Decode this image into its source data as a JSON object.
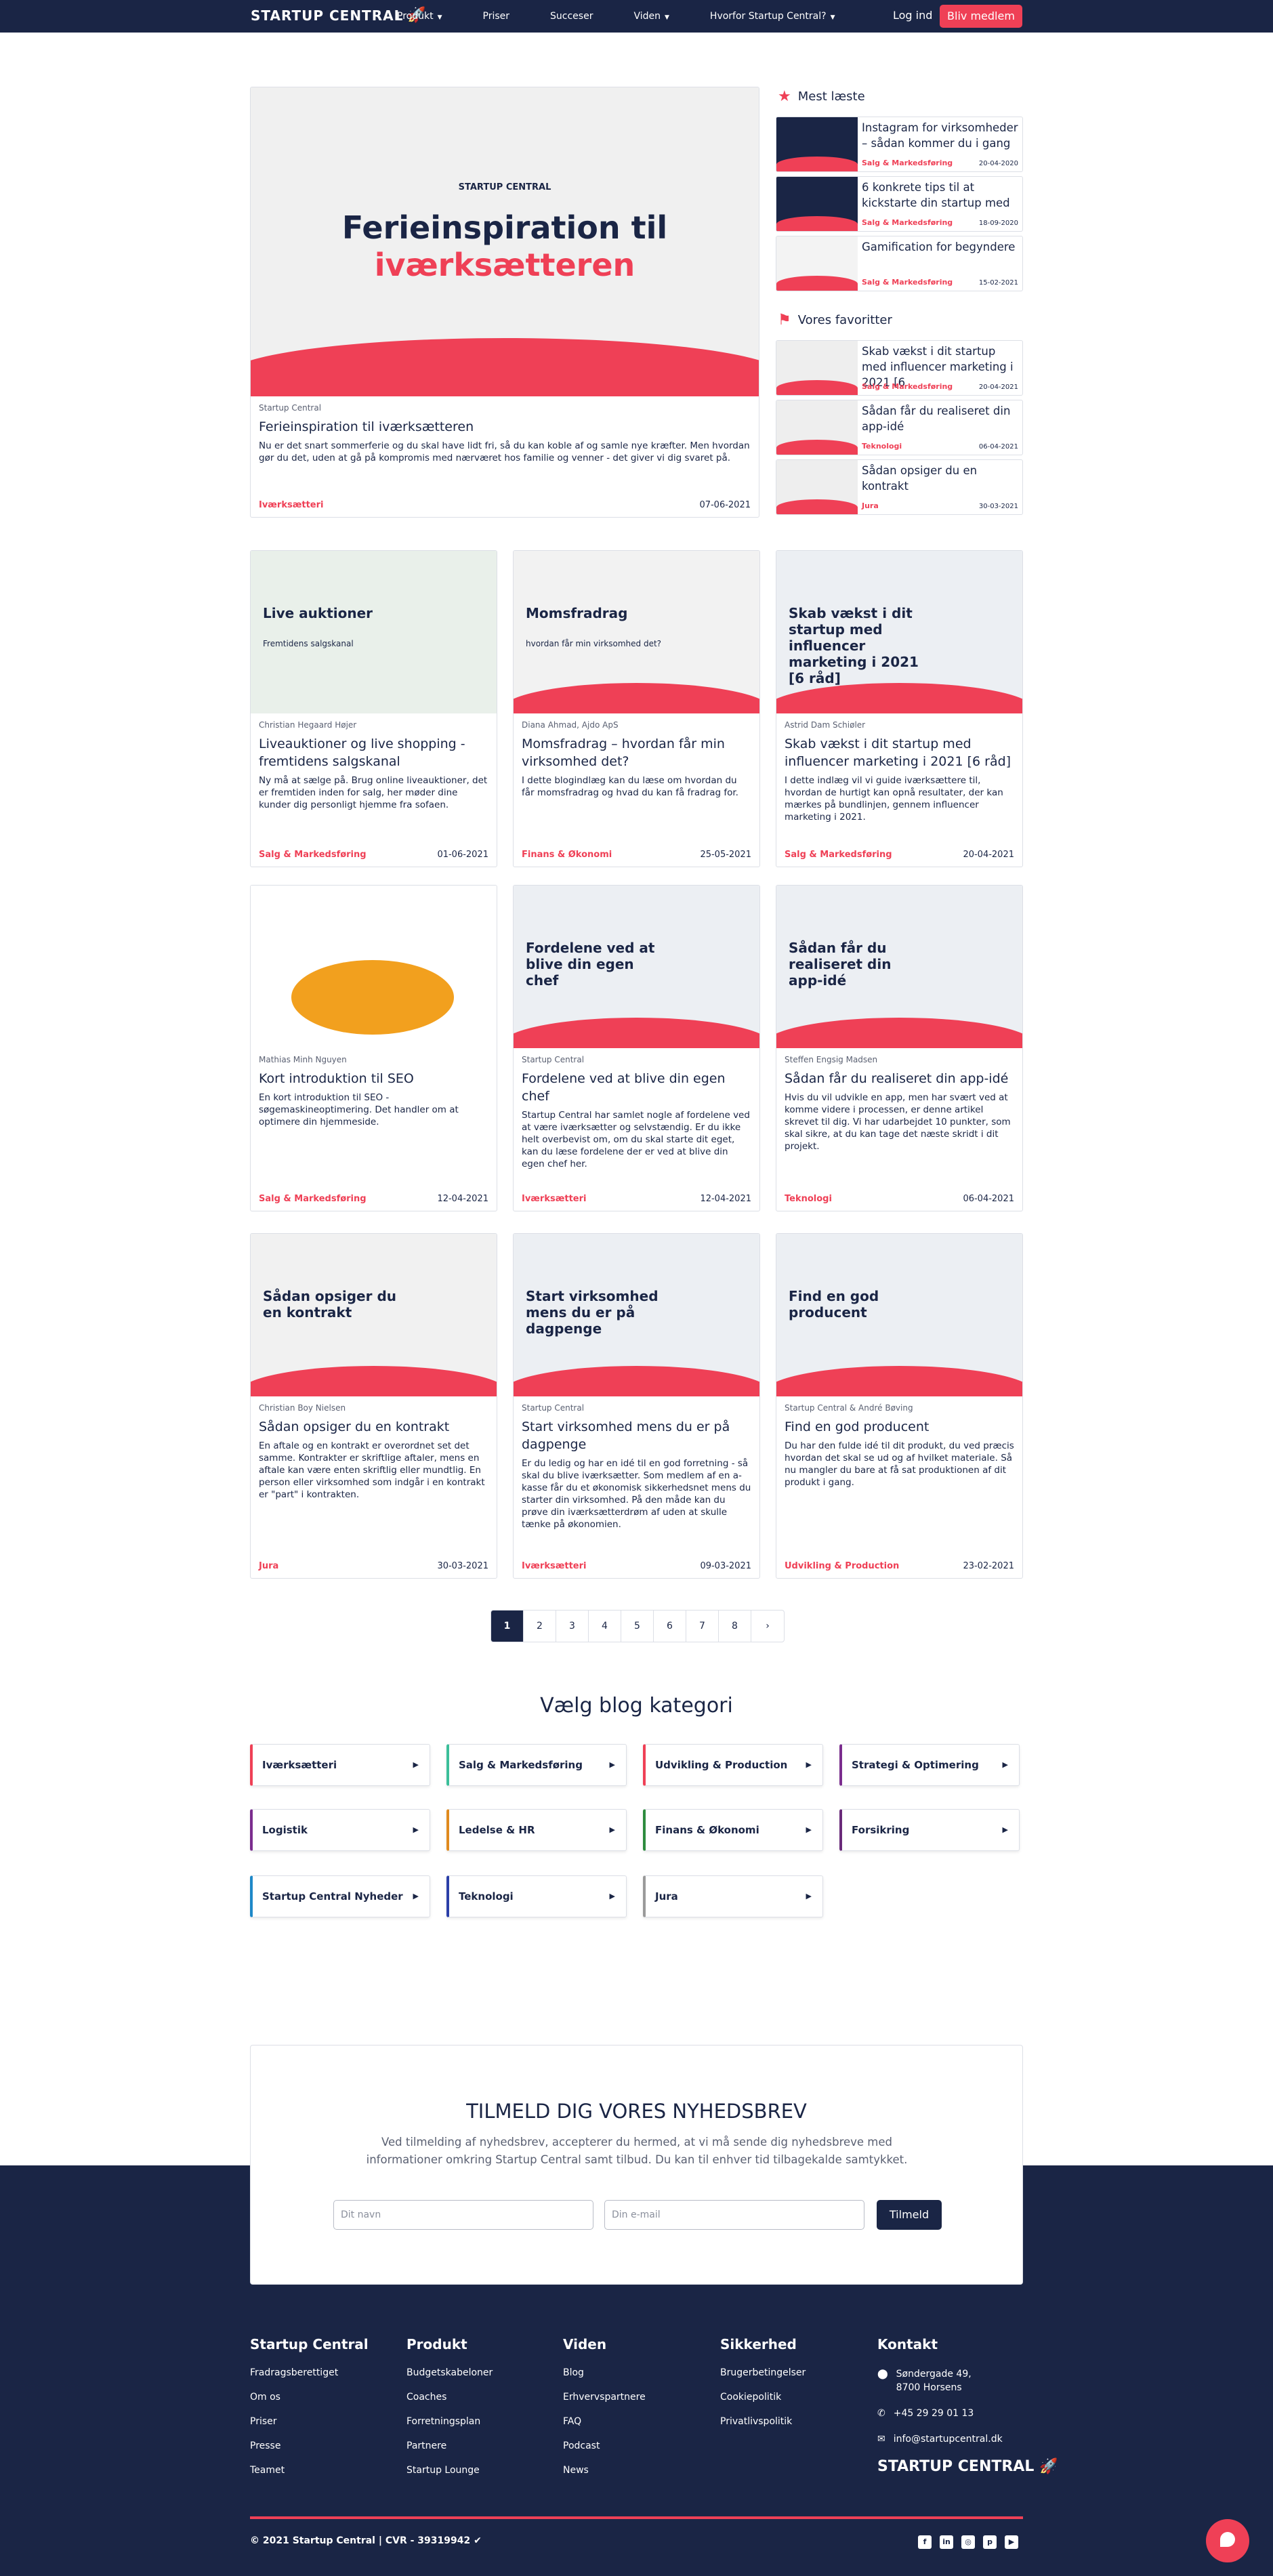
{
  "nav": {
    "logo": "STARTUP CENTRAL",
    "items": [
      "Produkt",
      "Priser",
      "Succeser",
      "Viden",
      "Hvorfor Startup Central?"
    ],
    "login": "Log ind",
    "join": "Bliv medlem"
  },
  "featured": {
    "image_brand": "STARTUP CENTRAL",
    "image_line1": "Ferieinspiration til",
    "image_line2": "iværksætteren",
    "author": "Startup Central",
    "title": "Ferieinspiration til iværksætteren",
    "desc": "Nu er det snart sommerferie og du skal have lidt fri, så du kan koble af og samle nye kræfter. Men hvordan gør du det, uden at gå på kompromis med nærværet hos familie og venner - det giver vi dig svaret på.",
    "category": "Iværksætteri",
    "date": "07-06-2021"
  },
  "sidebar": {
    "most_read_title": "Mest læste",
    "most_read": [
      {
        "title": "Instagram for virksomheder – sådan kommer du i gang",
        "category": "Salg & Markedsføring",
        "date": "20-04-2020",
        "color": "#1a2545"
      },
      {
        "title": "6 konkrete tips til at kickstarte din startup med",
        "category": "Salg & Markedsføring",
        "date": "18-09-2020",
        "color": "#1a2545"
      },
      {
        "title": "Gamification for begyndere",
        "category": "Salg & Markedsføring",
        "date": "15-02-2021",
        "color": "#f3f3f3"
      }
    ],
    "favorites_title": "Vores favoritter",
    "favorites": [
      {
        "title": "Skab vækst i dit startup med influencer marketing i 2021 [6",
        "category": "Salg & Markedsføring",
        "date": "20-04-2021",
        "color": "#eeeeee"
      },
      {
        "title": "Sådan får du realiseret din app-idé",
        "category": "Teknologi",
        "date": "06-04-2021",
        "color": "#eeeeee"
      },
      {
        "title": "Sådan opsiger du en kontrakt",
        "category": "Jura",
        "date": "30-03-2021",
        "color": "#eeeeee"
      }
    ]
  },
  "articles": [
    {
      "img_text": "Live auktioner",
      "img_sub": "Fremtidens salgskanal",
      "author": "Christian Hegaard Højer",
      "title": "Liveauktioner og live shopping - fremtidens salgskanal",
      "desc": "Ny må at sælge på. Brug online liveauktioner, det er fremtiden inden for salg, her møder dine kunder dig personligt hjemme fra sofaen.",
      "category": "Salg & Markedsføring",
      "date": "01-06-2021"
    },
    {
      "img_text": "Momsfradrag",
      "img_sub": "hvordan får min virksomhed det?",
      "author": "Diana Ahmad, Ajdo ApS",
      "title": "Momsfradrag – hvordan får min virksomhed det?",
      "desc": "I dette blogindlæg kan du læse om hvordan du får momsfradrag og hvad du kan få fradrag for.",
      "category": "Finans & Økonomi",
      "date": "25-05-2021"
    },
    {
      "img_text": "Skab vækst i dit startup med influencer marketing i 2021 [6 råd]",
      "img_sub": "",
      "author": "Astrid Dam Schiøler",
      "title": "Skab vækst i dit startup med influencer marketing i 2021 [6 råd]",
      "desc": "I dette indlæg vil vi guide iværksættere til, hvordan de hurtigt kan opnå resultater, der kan mærkes på bundlinjen, gennem influencer marketing i 2021.",
      "category": "Salg & Markedsføring",
      "date": "20-04-2021"
    },
    {
      "img_text": "",
      "img_sub": "",
      "author": "Mathias Minh Nguyen",
      "title": "Kort introduktion til SEO",
      "desc": "En kort introduktion til SEO - søgemaskineoptimering. Det handler om at optimere din hjemmeside.",
      "category": "Salg & Markedsføring",
      "date": "12-04-2021"
    },
    {
      "img_text": "Fordelene ved at blive din egen chef",
      "img_sub": "",
      "author": "Startup Central",
      "title": "Fordelene ved at blive din egen chef",
      "desc": "Startup Central har samlet nogle af fordelene ved at være iværksætter og selvstændig. Er du ikke helt overbevist om, om du skal starte dit eget, kan du læse fordelene der er ved at blive din egen chef her.",
      "category": "Iværksætteri",
      "date": "12-04-2021"
    },
    {
      "img_text": "Sådan får du realiseret din app-idé",
      "img_sub": "",
      "author": "Steffen Engsig Madsen",
      "title": "Sådan får du realiseret din app-idé",
      "desc": "Hvis du vil udvikle en app, men har svært ved at komme videre i processen, er denne artikel skrevet til dig. Vi har udarbejdet 10 punkter, som skal sikre, at du kan tage det næste skridt i dit projekt.",
      "category": "Teknologi",
      "date": "06-04-2021"
    },
    {
      "img_text": "Sådan opsiger du en kontrakt",
      "img_sub": "",
      "author": "Christian Boy Nielsen",
      "title": "Sådan opsiger du en kontrakt",
      "desc": "En aftale og en kontrakt er overordnet set det samme. Kontrakter er skriftlige aftaler, mens en aftale kan være enten skriftlig eller mundtlig. En person eller virksomhed som indgår i en kontrakt er \"part\" i kontrakten.",
      "category": "Jura",
      "date": "30-03-2021"
    },
    {
      "img_text": "Start virksomhed mens du er på dagpenge",
      "img_sub": "",
      "author": "Startup Central",
      "title": "Start virksomhed mens du er på dagpenge",
      "desc": "Er du ledig og har en idé til en god forretning - så skal du blive iværksætter. Som medlem af en a-kasse får du et økonomisk sikkerhedsnet mens du starter din virksomhed. På den måde kan du prøve din iværksætterdrøm af uden at skulle tænke på økonomien.",
      "category": "Iværksætteri",
      "date": "09-03-2021"
    },
    {
      "img_text": "Find en god producent",
      "img_sub": "",
      "author": "Startup Central & André Bøving",
      "title": "Find en god producent",
      "desc": "Du har den fulde idé til dit produkt, du ved præcis hvordan det skal se ud og af hvilket materiale. Så nu mangler du bare at få sat produktionen af dit produkt i gang.",
      "category": "Udvikling & Production",
      "date": "23-02-2021"
    }
  ],
  "pagination": [
    "1",
    "2",
    "3",
    "4",
    "5",
    "6",
    "7",
    "8",
    "›"
  ],
  "categories_title": "Vælg blog kategori",
  "categories": [
    {
      "label": "Iværksætteri",
      "color": "#ef4056"
    },
    {
      "label": "Salg & Markedsføring",
      "color": "#3bbf9a"
    },
    {
      "label": "Udvikling & Production",
      "color": "#ef4056"
    },
    {
      "label": "Strategi & Optimering",
      "color": "#7b2d8e"
    },
    {
      "label": "Logistik",
      "color": "#7b2d8e"
    },
    {
      "label": "Ledelse & HR",
      "color": "#e08a1e"
    },
    {
      "label": "Finans & Økonomi",
      "color": "#2e8b3e"
    },
    {
      "label": "Forsikring",
      "color": "#6a2a7a"
    },
    {
      "label": "Startup Central Nyheder",
      "color": "#1e88c8"
    },
    {
      "label": "Teknologi",
      "color": "#2b3fa8"
    },
    {
      "label": "Jura",
      "color": "#9a9a9a"
    }
  ],
  "newsletter": {
    "title": "TILMELD DIG VORES NYHEDSBREV",
    "text": "Ved tilmelding af nyhedsbrev, accepterer du hermed, at vi må sende dig nyhedsbreve med informationer omkring Startup Central samt tilbud. Du kan til enhver tid tilbagekalde samtykket.",
    "name_placeholder": "Dit navn",
    "email_placeholder": "Din e-mail",
    "button": "Tilmeld"
  },
  "footer": {
    "cols": [
      {
        "title": "Startup Central",
        "items": [
          "Fradragsberettiget",
          "Om os",
          "Priser",
          "Presse",
          "Teamet"
        ]
      },
      {
        "title": "Produkt",
        "items": [
          "Budgetskabeloner",
          "Coaches",
          "Forretningsplan",
          "Partnere",
          "Startup Lounge"
        ]
      },
      {
        "title": "Viden",
        "items": [
          "Blog",
          "Erhvervspartnere",
          "FAQ",
          "Podcast",
          "News"
        ]
      },
      {
        "title": "Sikkerhed",
        "items": [
          "Brugerbetingelser",
          "Cookiepolitik",
          "Privatlivspolitik"
        ]
      }
    ],
    "contact_title": "Kontakt",
    "address1": "Søndergade 49,",
    "address2": "8700 Horsens",
    "phone": "+45 29 29 01 13",
    "email": "info@startupcentral.dk",
    "logo": "STARTUP CENTRAL",
    "copyright": "© 2021 Startup Central | CVR - 39319942"
  }
}
